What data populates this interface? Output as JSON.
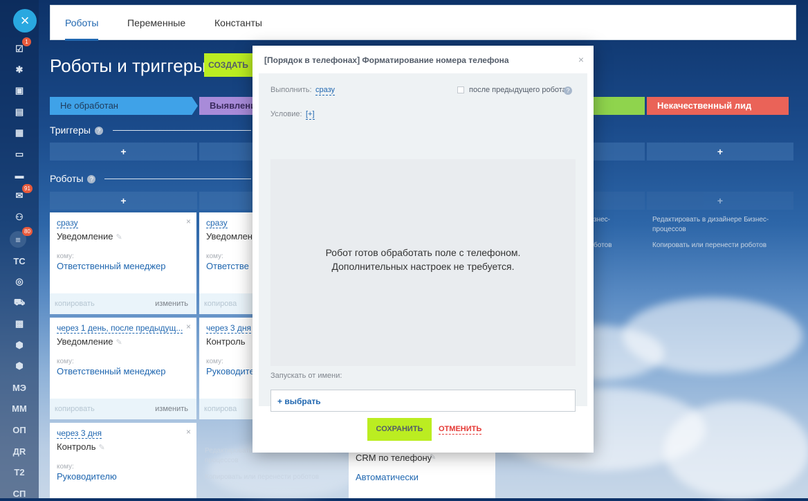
{
  "sidebar": {
    "close_icon": "×",
    "items": [
      {
        "icon": "tasks-icon",
        "glyph": "☑",
        "badge": "1"
      },
      {
        "icon": "feed-icon",
        "glyph": "✱",
        "badge": ""
      },
      {
        "icon": "chat-icon",
        "glyph": "▣",
        "badge": ""
      },
      {
        "icon": "messages-icon",
        "glyph": "▤",
        "badge": ""
      },
      {
        "icon": "calendar-icon",
        "glyph": "▦",
        "badge": ""
      },
      {
        "icon": "document-icon",
        "glyph": "▭",
        "badge": ""
      },
      {
        "icon": "drive-icon",
        "glyph": "▬",
        "badge": ""
      },
      {
        "icon": "mail-icon",
        "glyph": "✉",
        "badge": "91"
      },
      {
        "icon": "group-icon",
        "glyph": "⚇",
        "badge": ""
      },
      {
        "icon": "crm-filter-icon",
        "glyph": "≡",
        "badge": "80"
      },
      {
        "icon": "",
        "glyph": "ТС",
        "badge": ""
      },
      {
        "icon": "target-icon",
        "glyph": "◎",
        "badge": ""
      },
      {
        "icon": "cart-icon",
        "glyph": "⛟",
        "badge": ""
      },
      {
        "icon": "contact-card-icon",
        "glyph": "▩",
        "badge": ""
      },
      {
        "icon": "box-icon",
        "glyph": "⬢",
        "badge": ""
      },
      {
        "icon": "box-icon",
        "glyph": "⬢",
        "badge": ""
      },
      {
        "icon": "",
        "glyph": "МЭ",
        "badge": ""
      },
      {
        "icon": "",
        "glyph": "ММ",
        "badge": ""
      },
      {
        "icon": "",
        "glyph": "ОП",
        "badge": ""
      },
      {
        "icon": "",
        "glyph": "ДR",
        "badge": ""
      },
      {
        "icon": "",
        "glyph": "Т2",
        "badge": ""
      },
      {
        "icon": "",
        "glyph": "СП",
        "badge": ""
      }
    ]
  },
  "tabs": [
    "Роботы",
    "Переменные",
    "Константы"
  ],
  "page": {
    "title": "Роботы и триггеры",
    "create_label": "СОЗДАТЬ",
    "triggers_title": "Триггеры",
    "robots_title": "Роботы",
    "help_glyph": "?",
    "add_glyph": "+"
  },
  "stages": [
    {
      "label": "Не обработан",
      "color": "#3fa2e8"
    },
    {
      "label": "Выявление",
      "color": "#a88bd9"
    },
    {
      "label": "",
      "color": "#8fd44d"
    },
    {
      "label": "Некачественный лид",
      "color": "#ea6358"
    }
  ],
  "cards": [
    {
      "when": "сразу",
      "name": "Уведомление",
      "to_label": "кому:",
      "to": "Ответственный менеджер",
      "copy": "копировать",
      "edit": "изменить"
    },
    {
      "when": "сразу",
      "name": "Уведомлени",
      "to_label": "кому:",
      "to": "Ответстве",
      "copy": "копирова",
      "edit": ""
    },
    {
      "when": "через 1 день, после предыдущ...",
      "name": "Уведомление",
      "to_label": "кому:",
      "to": "Ответственный менеджер",
      "copy": "копировать",
      "edit": "изменить"
    },
    {
      "when": "через 3 дня",
      "name": "Контроль",
      "to_label": "кому:",
      "to": "Руководите",
      "copy": "копирова",
      "edit": ""
    },
    {
      "when": "через 3 дня",
      "name": "Контроль",
      "to_label": "кому:",
      "to": "Руководителю",
      "copy": "",
      "edit": ""
    }
  ],
  "ghost_texts": {
    "design_edit_short": "Редактировать в",
    "design_edit_full": "Редактировать в дизайнере Бизнес-",
    "processes": "процессов",
    "copy_move": "Копировать или перенести роботов",
    "biz_suffix": "знес-",
    "robots_suffix": "ботов"
  },
  "partial_card": {
    "name": "CRM по телефону",
    "to": "Автоматически"
  },
  "modal": {
    "title": "[Порядок в телефонах] Форматирование номера телефона",
    "close": "×",
    "execute_label": "Выполнить:",
    "execute_value": "сразу",
    "after_prev_label": "после предыдущего робота",
    "condition_label": "Условие:",
    "condition_value": "[+]",
    "message_line1": "Робот готов обработать поле с телефоном.",
    "message_line2": "Дополнительных настроек не требуется.",
    "run_as_label": "Запускать от имени:",
    "select_label": "+ выбрать",
    "save_label": "СОХРАНИТЬ",
    "cancel_label": "ОТМЕНИТЬ"
  }
}
